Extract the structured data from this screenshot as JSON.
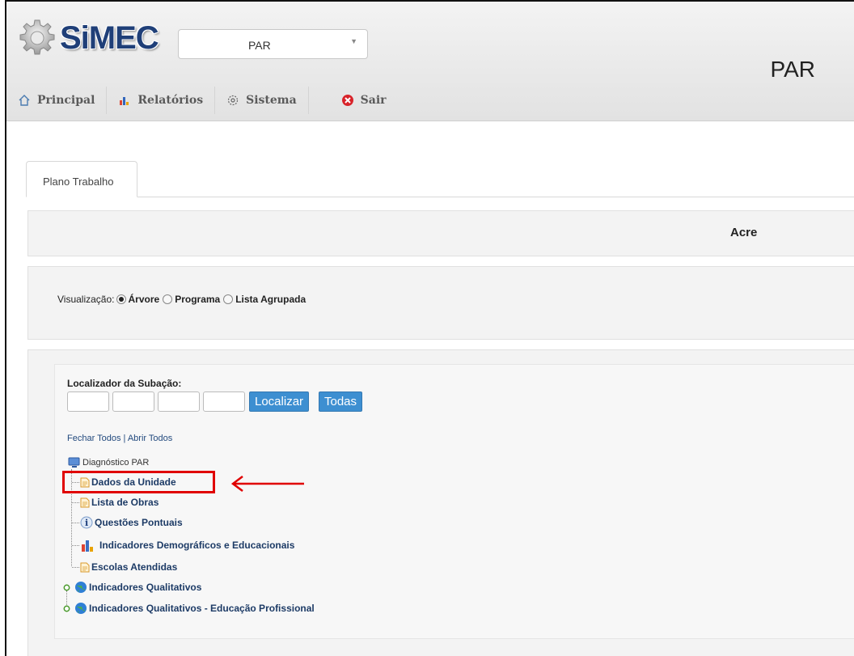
{
  "header": {
    "logo_text": "SiMEC",
    "system_select_value": "PAR",
    "app_title": "PAR"
  },
  "menu": [
    {
      "label": "Principal",
      "icon": "home-icon"
    },
    {
      "label": "Relatórios",
      "icon": "bar-chart-icon"
    },
    {
      "label": "Sistema",
      "icon": "gear-icon"
    },
    {
      "label": "Sair",
      "icon": "exit-icon"
    }
  ],
  "tabs": [
    {
      "label": "Plano Trabalho"
    }
  ],
  "state": {
    "name": "Acre"
  },
  "visualization": {
    "label": "Visualização:",
    "options": [
      "Árvore",
      "Programa",
      "Lista Agrupada"
    ],
    "selected": "Árvore"
  },
  "locator": {
    "label": "Localizador da Subação:",
    "inputs": [
      "",
      "",
      "",
      ""
    ],
    "search_button": "Localizar",
    "all_button": "Todas"
  },
  "tree_controls": {
    "close_all": "Fechar Todos",
    "separator": "|",
    "open_all": "Abrir Todos"
  },
  "tree": {
    "root": "Diagnóstico PAR",
    "items": [
      {
        "label": "Dados da Unidade",
        "icon": "document-icon"
      },
      {
        "label": "Lista de Obras",
        "icon": "document-icon"
      },
      {
        "label": "Questões Pontuais",
        "icon": "info-icon"
      },
      {
        "label": "Indicadores Demográficos e Educacionais",
        "icon": "bar-chart-icon"
      },
      {
        "label": "Escolas Atendidas",
        "icon": "document-icon"
      },
      {
        "label": "Indicadores Qualitativos",
        "icon": "globe-icon"
      },
      {
        "label": "Indicadores Qualitativos - Educação Profissional",
        "icon": "globe-icon"
      }
    ]
  },
  "colors": {
    "accent_button": "#3d8fd1",
    "highlight": "#e00000",
    "link": "#1d3b66"
  }
}
